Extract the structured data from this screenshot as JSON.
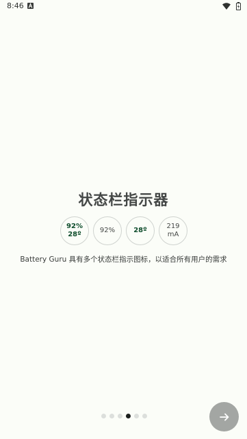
{
  "status_bar": {
    "time": "8:46",
    "notification_icon": "font-a-icon",
    "wifi_icon": "wifi-icon",
    "battery_icon": "battery-charging-icon"
  },
  "page": {
    "title": "状态栏指示器",
    "indicators": [
      {
        "line1": "92%",
        "line2": "28º"
      },
      {
        "line1": "92%",
        "line2": ""
      },
      {
        "line1": "28º",
        "line2": ""
      },
      {
        "line1": "219",
        "line2": "mA"
      }
    ],
    "description": "Battery Guru 具有多个状态栏指示图标，以适合所有用户的需求"
  },
  "pager": {
    "total_pages": 6,
    "active_index": 3,
    "next_icon": "arrow-right-icon"
  },
  "colors": {
    "background": "#fbfdf8",
    "accent_text": "#0f4d2c",
    "next_button": "#a3a6a3"
  }
}
